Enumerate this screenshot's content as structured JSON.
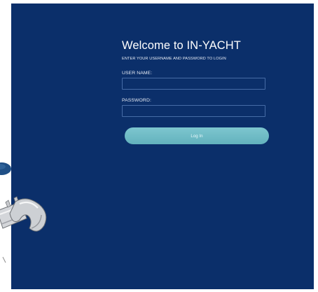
{
  "login": {
    "title": "Welcome to IN-YACHT",
    "subtitle": "ENTER YOUR USERNAME AND PASSWORD TO LOGIN",
    "username_label": "USER NAME:",
    "username_value": "",
    "password_label": "PASSWORD:",
    "password_value": "",
    "button_label": "Log In"
  },
  "colors": {
    "panel_background": "#0b2f6a",
    "input_border": "#466ca6",
    "button_color": "#70bcc6",
    "page_background": "#ffffff"
  },
  "icons": {
    "left_ellipse": "blue-ellipse-icon",
    "wrench": "wrench-icon"
  }
}
